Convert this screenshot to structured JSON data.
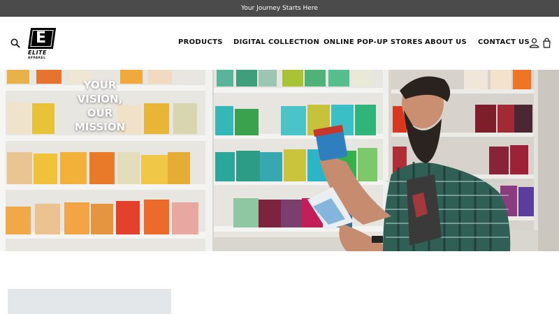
{
  "announcement": {
    "text": "Your Journey Starts Here"
  },
  "brand": {
    "logo_letter": "E",
    "name": "ELITE",
    "tagline": "APPAREL"
  },
  "nav": {
    "products": "PRODUCTS",
    "digital_collection": "DIGITAL COLLECTION",
    "popup_stores": "ONLINE POP-UP STORES",
    "about": "ABOUT US",
    "contact": "CONTACT US"
  },
  "icons": {
    "search": "search-icon",
    "account": "user-icon",
    "cart": "cart-icon"
  },
  "hero": {
    "line1": "YOUR",
    "line2": "VISION,",
    "line3": "OUR",
    "line4": "MISSION",
    "image_alt": "Man holding paint pot in front of shelves of ink tubs"
  },
  "colors": {
    "announcement_bg": "#4b4b4b",
    "text_primary": "#111111",
    "hero_text": "#ffffff"
  }
}
